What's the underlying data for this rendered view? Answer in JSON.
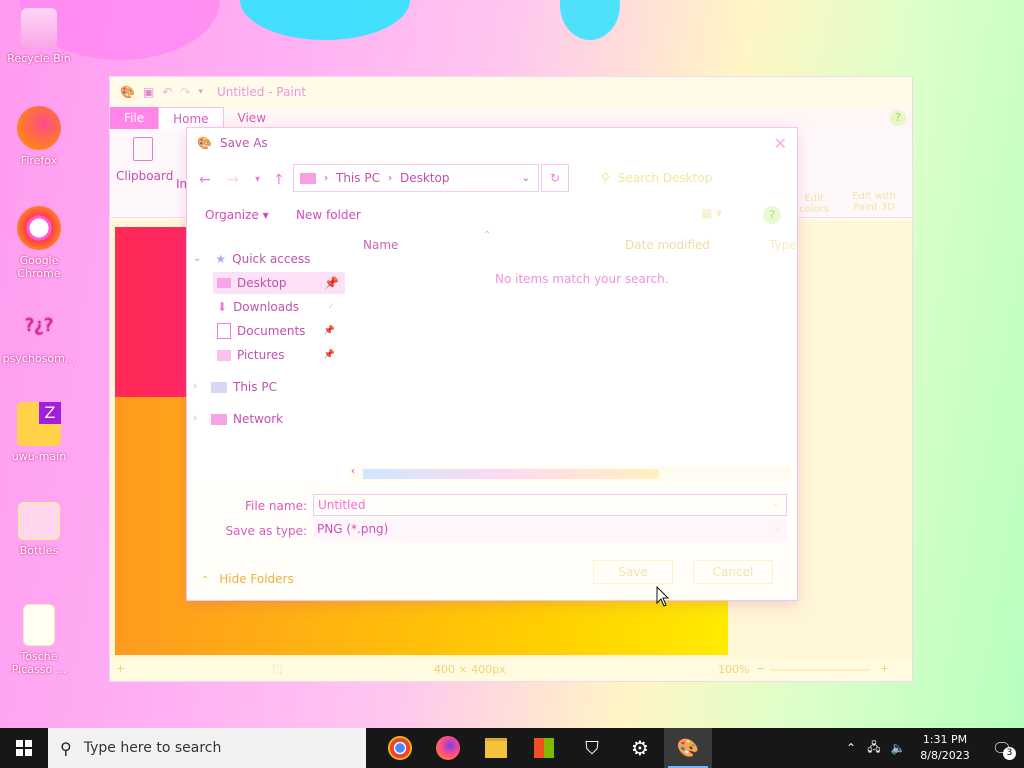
{
  "desktop": {
    "icons": [
      {
        "label": "Recycle Bin",
        "icon": "recycle-bin-icon"
      },
      {
        "label": "Firefox",
        "icon": "firefox-icon"
      },
      {
        "label": "Google Chrome",
        "icon": "chrome-icon"
      },
      {
        "label": "psychosom...",
        "icon": "psychosomatic-file-icon"
      },
      {
        "label": "uwu-main",
        "icon": "zipped-folder-icon"
      },
      {
        "label": "Bottles",
        "icon": "bottles-icon"
      },
      {
        "label": "Tosche Picasso ...",
        "icon": "document-shortcut-icon"
      }
    ]
  },
  "paint": {
    "title": "Untitled - Paint",
    "tabs": [
      "File",
      "Home",
      "View"
    ],
    "ribbon": {
      "clipboard": "Clipboard",
      "image_partial": "Im",
      "edit_with_paint": "Edit with Paint 3D",
      "edit_colors": "Edit colors"
    },
    "status": {
      "dimensions": "400 × 400px",
      "zoom": "100%"
    }
  },
  "dialog": {
    "title": "Save As",
    "address": {
      "root": "This PC",
      "folder": "Desktop"
    },
    "search_placeholder": "Search Desktop",
    "toolbar": {
      "organize": "Organize",
      "new_folder": "New folder"
    },
    "columns": {
      "name": "Name",
      "date": "Date modified",
      "type": "Type"
    },
    "empty_message": "No items match your search.",
    "nav": {
      "quick_access": "Quick access",
      "desktop": "Desktop",
      "downloads": "Downloads",
      "documents": "Documents",
      "pictures": "Pictures",
      "this_pc": "This PC",
      "network": "Network"
    },
    "file_name_label": "File name:",
    "file_name_value": "Untitled",
    "save_as_type_label": "Save as type:",
    "save_as_type_value": "PNG (*.png)",
    "hide_folders": "Hide Folders",
    "save_button": "Save",
    "cancel_button": "Cancel"
  },
  "taskbar": {
    "search_placeholder": "Type here to search",
    "apps": [
      "chrome-icon",
      "firefox-icon",
      "file-explorer-icon",
      "microsoft-store-icon",
      "security-shield-icon",
      "settings-gear-icon",
      "paint-icon"
    ],
    "time": "1:31 PM",
    "date": "8/8/2023",
    "notification_count": "3"
  }
}
